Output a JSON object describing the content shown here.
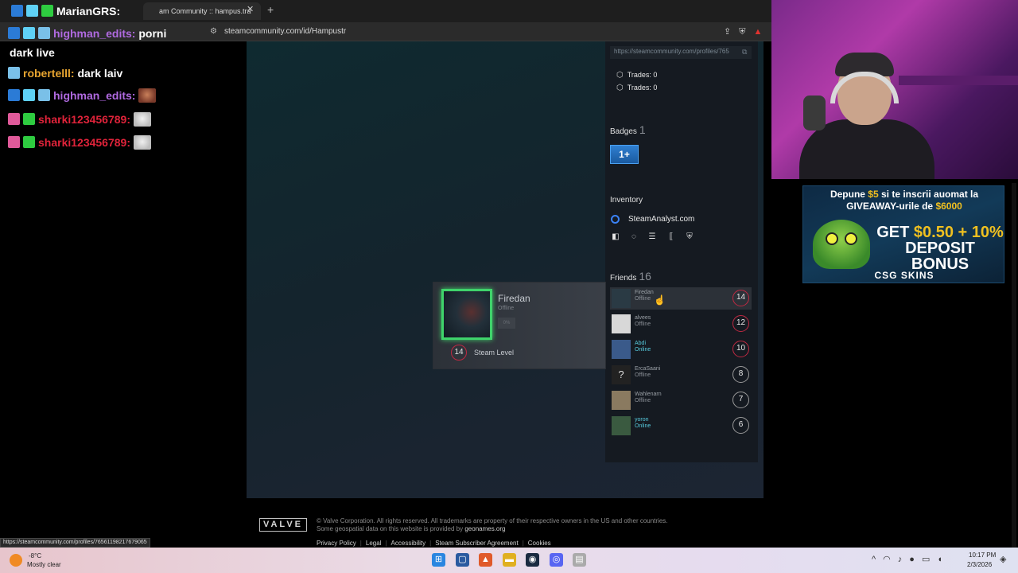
{
  "browser": {
    "tab_title": "am Community :: hampus.tra",
    "tab_close": "✕",
    "new_tab": "+",
    "url": "steamcommunity.com/id/Hampustr",
    "status_url": "https://steamcommunity.com/profiles/76561198217679065"
  },
  "profile": {
    "profile_url": "https://steamcommunity.com/profiles/765",
    "trades": [
      "Trades: 0",
      "Trades: 0"
    ],
    "badges_title": "Badges",
    "badges_count": "1",
    "badge_tile": "1+",
    "inventory_title": "Inventory",
    "steamanalyst": "SteamAnalyst.com",
    "friends_title": "Friends",
    "friends_count": "16",
    "friends": [
      {
        "name": "Firedan",
        "status": "Offline",
        "level": "14"
      },
      {
        "name": "alvees",
        "status": "Offline",
        "level": "12"
      },
      {
        "name": "Abdi",
        "status": "Online",
        "level": "10"
      },
      {
        "name": "ErcaSaani",
        "status": "Offline",
        "level": "8"
      },
      {
        "name": "Wahlenarn",
        "status": "Offline",
        "level": "7"
      },
      {
        "name": "yoron",
        "status": "Online",
        "level": "6"
      }
    ]
  },
  "hovercard": {
    "name": "Firedan",
    "status": "Offline",
    "pct": "0%",
    "level": "14",
    "level_label": "Steam Level"
  },
  "footer": {
    "valve": "VALVE",
    "copyright_1": "© Valve Corporation. All rights reserved. All trademarks are property of their respective owners in the US and other countries.",
    "copyright_2": "Some geospatial data on this website is provided by",
    "geonames": "geonames.org",
    "links": [
      "Privacy Policy",
      "Legal",
      "Accessibility",
      "Steam Subscriber Agreement",
      "Cookies"
    ]
  },
  "chat": {
    "top_user": "MarianGRS:",
    "lines": [
      {
        "user": "highman_edits:",
        "user_color": "#b06ae0",
        "msg": "porni"
      },
      {
        "user": "",
        "user_color": "#ffffff",
        "msg": "dark live"
      },
      {
        "user": "robertelll:",
        "user_color": "#e8a530",
        "msg": "dark laiv"
      },
      {
        "user": "highman_edits:",
        "user_color": "#b06ae0",
        "msg": ""
      },
      {
        "user": "sharki123456789:",
        "user_color": "#e0233a",
        "msg": ""
      },
      {
        "user": "sharki123456789:",
        "user_color": "#e0233a",
        "msg": ""
      }
    ]
  },
  "ad": {
    "line1_pre": "Depune ",
    "line1_amt": "$5",
    "line1_post": " si te inscrii auomat la",
    "line2_pre": "GIVEAWAY-urile de ",
    "line2_amt": "$6000",
    "main1_pre": "GET ",
    "main1_amt": "$0.50 + 10%",
    "main2": "DEPOSIT BONUS",
    "brand": "CSG SKINS"
  },
  "taskbar": {
    "temp": "-8°C",
    "weather": "Mostly clear",
    "time": "10:17 PM",
    "date": "2/3/2026"
  },
  "colors": {
    "level_ring_red": "#c02942",
    "online": "#57cbde",
    "hover_ring": "#3fd36b"
  }
}
